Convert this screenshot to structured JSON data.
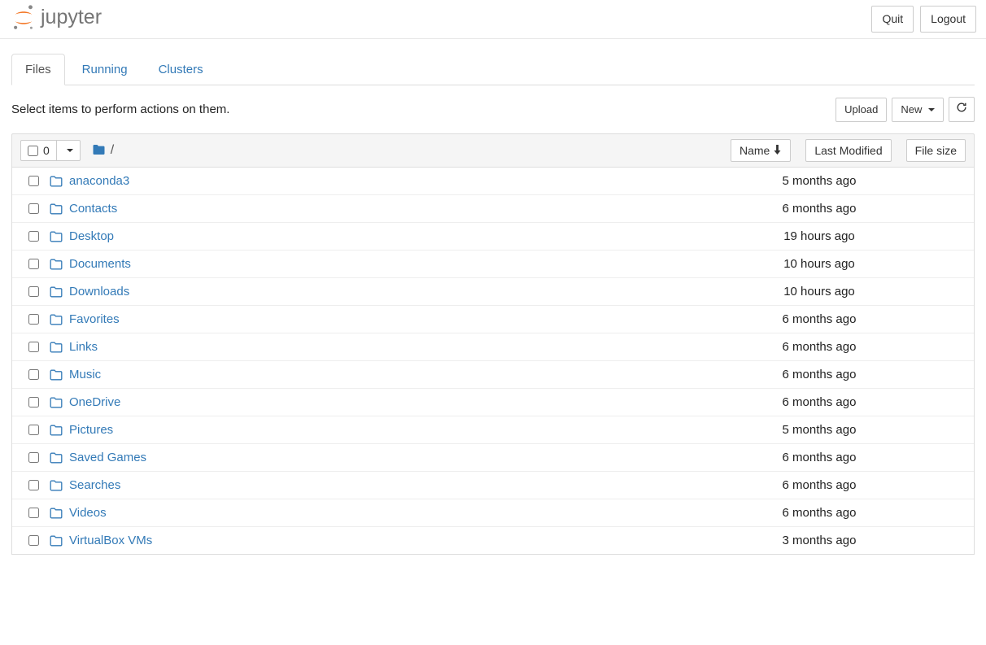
{
  "brand": {
    "name": "jupyter"
  },
  "header": {
    "quit": "Quit",
    "logout": "Logout"
  },
  "tabs": {
    "files": "Files",
    "running": "Running",
    "clusters": "Clusters"
  },
  "toolbar": {
    "hint": "Select items to perform actions on them.",
    "upload": "Upload",
    "new": "New"
  },
  "list": {
    "selected_count": "0",
    "breadcrumb_sep": "/",
    "columns": {
      "name": "Name",
      "modified": "Last Modified",
      "size": "File size"
    },
    "items": [
      {
        "name": "anaconda3",
        "modified": "5 months ago",
        "size": ""
      },
      {
        "name": "Contacts",
        "modified": "6 months ago",
        "size": ""
      },
      {
        "name": "Desktop",
        "modified": "19 hours ago",
        "size": ""
      },
      {
        "name": "Documents",
        "modified": "10 hours ago",
        "size": ""
      },
      {
        "name": "Downloads",
        "modified": "10 hours ago",
        "size": ""
      },
      {
        "name": "Favorites",
        "modified": "6 months ago",
        "size": ""
      },
      {
        "name": "Links",
        "modified": "6 months ago",
        "size": ""
      },
      {
        "name": "Music",
        "modified": "6 months ago",
        "size": ""
      },
      {
        "name": "OneDrive",
        "modified": "6 months ago",
        "size": ""
      },
      {
        "name": "Pictures",
        "modified": "5 months ago",
        "size": ""
      },
      {
        "name": "Saved Games",
        "modified": "6 months ago",
        "size": ""
      },
      {
        "name": "Searches",
        "modified": "6 months ago",
        "size": ""
      },
      {
        "name": "Videos",
        "modified": "6 months ago",
        "size": ""
      },
      {
        "name": "VirtualBox VMs",
        "modified": "3 months ago",
        "size": ""
      }
    ]
  }
}
